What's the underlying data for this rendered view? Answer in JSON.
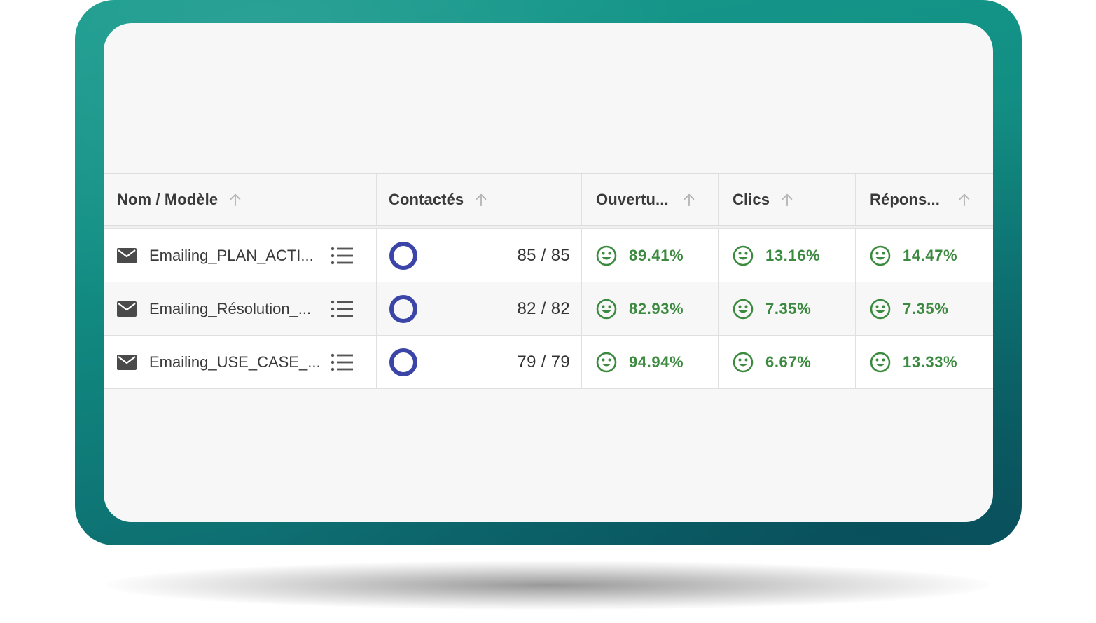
{
  "table": {
    "columns": [
      {
        "label": "Nom / Modèle"
      },
      {
        "label": "Contactés"
      },
      {
        "label": "Ouvertu..."
      },
      {
        "label": "Clics"
      },
      {
        "label": "Répons..."
      }
    ],
    "rows": [
      {
        "name": "Emailing_PLAN_ACTI...",
        "contacted": "85 / 85",
        "opens": "89.41%",
        "clicks": "13.16%",
        "responses": "14.47%"
      },
      {
        "name": "Emailing_Résolution_...",
        "contacted": "82 / 82",
        "opens": "82.93%",
        "clicks": "7.35%",
        "responses": "7.35%"
      },
      {
        "name": "Emailing_USE_CASE_...",
        "contacted": "79 / 79",
        "opens": "94.94%",
        "clicks": "6.67%",
        "responses": "13.33%"
      }
    ]
  },
  "colors": {
    "frame": "#128f84",
    "ring": "#3b45a8",
    "positive": "#3b8a3f",
    "icon": "#4a4a4a"
  },
  "icons": {
    "row_type": "mail-icon",
    "row_action": "list-icon",
    "status": "ring-icon",
    "rate": "smiley-icon",
    "sort": "arrow-up-icon"
  }
}
